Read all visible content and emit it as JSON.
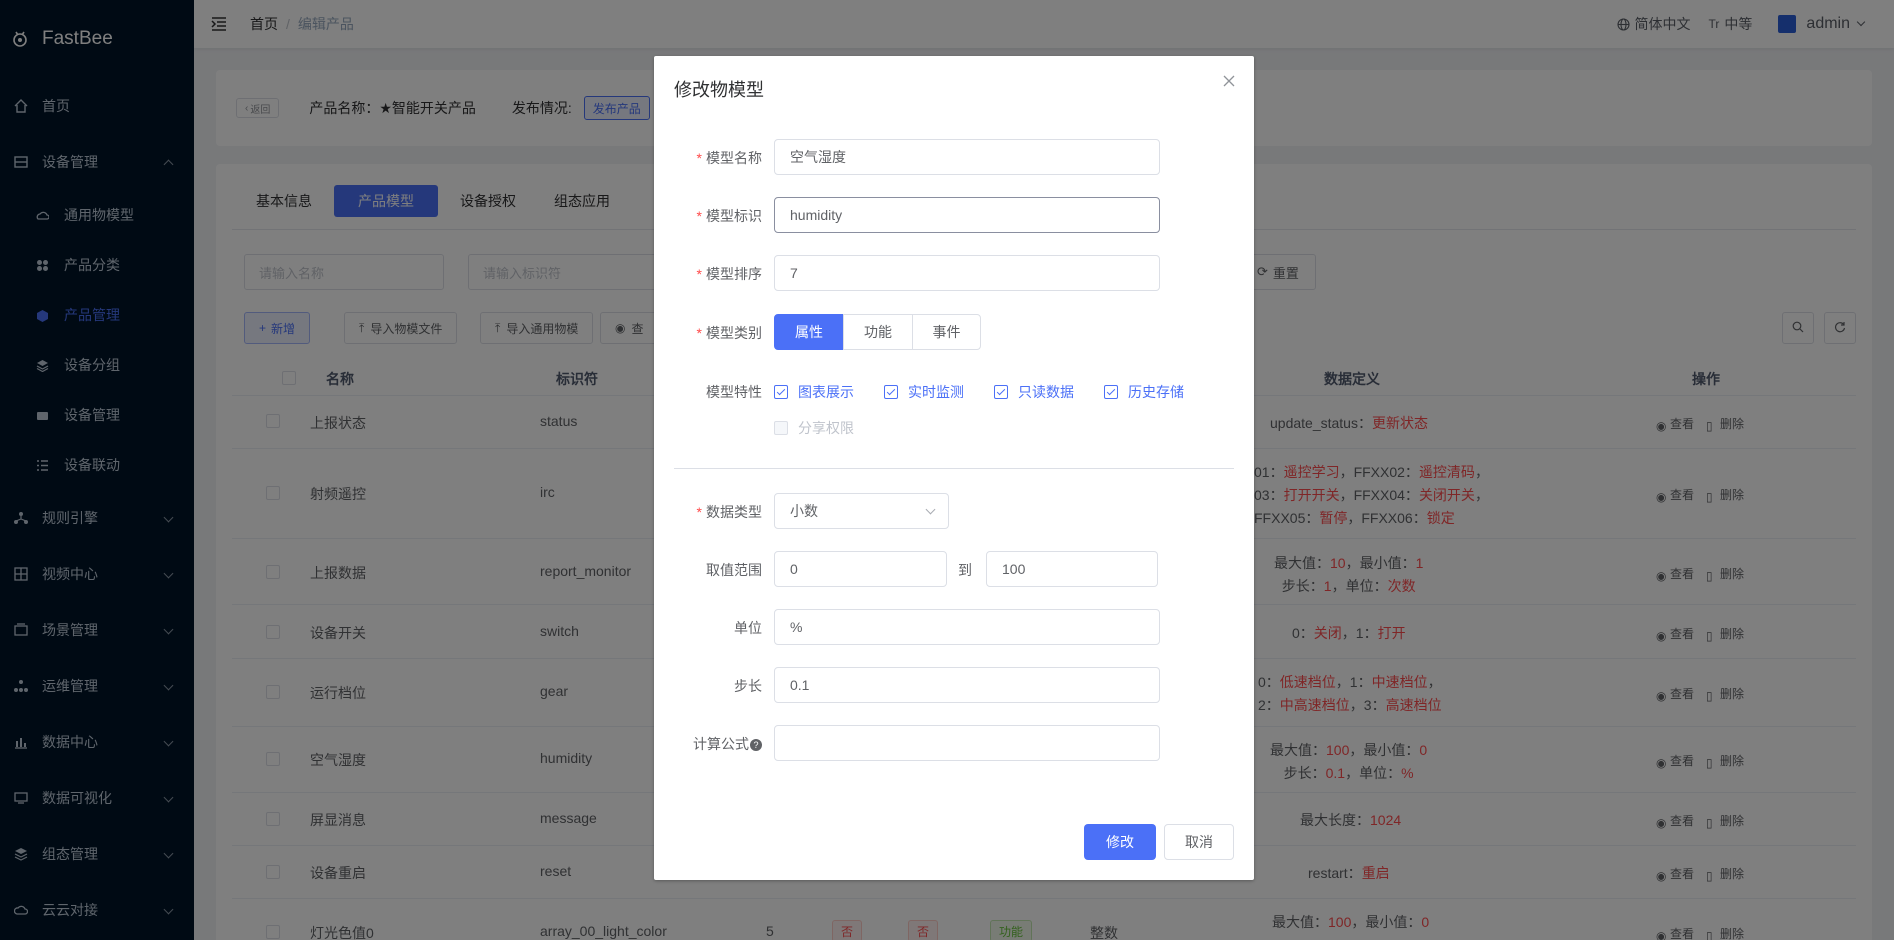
{
  "app": {
    "name": "FastBee"
  },
  "sidebar": {
    "items": [
      {
        "label": "首页"
      },
      {
        "label": "设备管理"
      },
      {
        "label": "规则引擎"
      },
      {
        "label": "视频中心"
      },
      {
        "label": "场景管理"
      },
      {
        "label": "运维管理"
      },
      {
        "label": "数据中心"
      },
      {
        "label": "数据可视化"
      },
      {
        "label": "组态管理"
      },
      {
        "label": "云云对接"
      }
    ],
    "subitems": [
      {
        "label": "通用物模型"
      },
      {
        "label": "产品分类"
      },
      {
        "label": "产品管理"
      },
      {
        "label": "设备分组"
      },
      {
        "label": "设备管理"
      },
      {
        "label": "设备联动"
      }
    ]
  },
  "header": {
    "breadcrumb": [
      "首页",
      "编辑产品"
    ],
    "lang": "简体中文",
    "size": "中等",
    "user": "admin"
  },
  "product": {
    "back": "返回",
    "name_label": "产品名称：★智能开关产品",
    "publish_label": "发布情况:",
    "publish_btn": "发布产品"
  },
  "tabs": [
    "基本信息",
    "产品模型",
    "设备授权",
    "组态应用"
  ],
  "search": {
    "name_ph": "请输入名称",
    "id_ph": "请输入标识符",
    "reset": "重置"
  },
  "toolbar": {
    "add": "新增",
    "import_model": "导入物模文件",
    "import_generic": "导入通用物模",
    "view": "查"
  },
  "table": {
    "headers": {
      "name": "名称",
      "identifier": "标识符",
      "datadef": "数据定义",
      "ops": "操作"
    },
    "view": "查看",
    "delete": "删除",
    "rows": [
      {
        "name": "上报状态",
        "id": "status"
      },
      {
        "name": "射频遥控",
        "id": "irc"
      },
      {
        "name": "上报数据",
        "id": "report_monitor"
      },
      {
        "name": "设备开关",
        "id": "switch"
      },
      {
        "name": "运行档位",
        "id": "gear"
      },
      {
        "name": "空气湿度",
        "id": "humidity"
      },
      {
        "name": "屏显消息",
        "id": "message"
      },
      {
        "name": "设备重启",
        "id": "reset"
      },
      {
        "name": "灯光色值0",
        "id": "array_00_light_color",
        "order": "5",
        "t1": "否",
        "t2": "否",
        "t3": "功能",
        "type": "整数"
      }
    ],
    "defs": {
      "r1": {
        "a": "update_status：",
        "b": "更新状态"
      },
      "r2": {
        "l1a": "01：",
        "l1b": "遥控学习",
        "l1c": "，FFXX02：",
        "l1d": "遥控清码",
        "l1e": "，",
        "l2a": "03：",
        "l2b": "打开开关",
        "l2c": "，FFXX04：",
        "l2d": "关闭开关",
        "l2e": "，",
        "l3a": "FFXX05：",
        "l3b": "暂停",
        "l3c": "，FFXX06：",
        "l3d": "锁定"
      },
      "r3": {
        "l1a": "最大值：",
        "l1b": "10",
        "l1c": "，最小值：",
        "l1d": "1",
        "l2a": "步长：",
        "l2b": "1",
        "l2c": "，单位：",
        "l2d": "次数"
      },
      "r4": {
        "a": "0：",
        "b": "关闭",
        "c": "，1：",
        "d": "打开"
      },
      "r5": {
        "l1a": "0：",
        "l1b": "低速档位",
        "l1c": "，1：",
        "l1d": "中速档位",
        "l1e": "，",
        "l2a": "2：",
        "l2b": "中高速档位",
        "l2c": "，3：",
        "l2d": "高速档位"
      },
      "r6": {
        "l1a": "最大值：",
        "l1b": "100",
        "l1c": "，最小值：",
        "l1d": "0",
        "l2a": "步长：",
        "l2b": "0.1",
        "l2c": "，单位：",
        "l2d": "%"
      },
      "r7": {
        "a": "最大长度：",
        "b": "1024"
      },
      "r8": {
        "a": "restart：",
        "b": "重启"
      },
      "r9": {
        "a": "最大值：",
        "b": "100",
        "c": "，最小值：",
        "d": "0"
      }
    }
  },
  "dialog": {
    "title": "修改物模型",
    "labels": {
      "name": "模型名称",
      "ident": "模型标识",
      "order": "模型排序",
      "category": "模型类别",
      "feature": "模型特性",
      "dtype": "数据类型",
      "range": "取值范围",
      "unit": "单位",
      "step": "步长",
      "formula": "计算公式"
    },
    "values": {
      "name": "空气湿度",
      "ident": "humidity",
      "order": "7",
      "dtype": "小数",
      "min": "0",
      "max": "100",
      "unit": "%",
      "step": "0.1",
      "formula": ""
    },
    "range_to": "到",
    "categories": [
      "属性",
      "功能",
      "事件"
    ],
    "features": [
      "图表展示",
      "实时监测",
      "只读数据",
      "历史存储"
    ],
    "share": "分享权限",
    "qmark": "?",
    "submit": "修改",
    "cancel": "取消"
  },
  "colors": {
    "primary": "#4b70f7",
    "sidebar": "#001529",
    "danger": "#ff4d4f"
  }
}
